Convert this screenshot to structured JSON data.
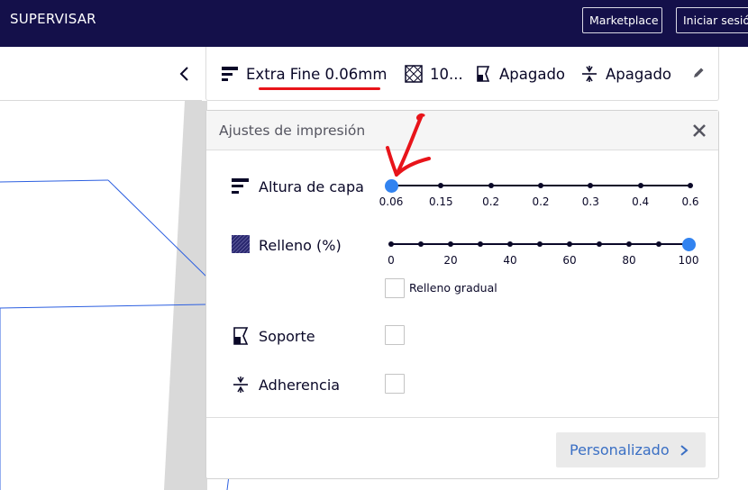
{
  "topbar": {
    "brand": "SUPERVISAR",
    "marketplace_label": "Marketplace",
    "login_label": "Iniciar sesión"
  },
  "summary": {
    "profile": "Extra Fine 0.06mm",
    "infill": "10...",
    "support": "Apagado",
    "adhesion": "Apagado"
  },
  "panel": {
    "title": "Ajustes de impresión",
    "layer_height": {
      "label": "Altura de capa",
      "ticks": [
        "0.06",
        "0.15",
        "0.2",
        "0.2",
        "0.3",
        "0.4",
        "0.6"
      ],
      "selected_index": 0
    },
    "infill": {
      "label": "Relleno (%)",
      "ticks": [
        "0",
        "20",
        "40",
        "60",
        "80",
        "100"
      ],
      "value_fraction": 1.0,
      "gradual_label": "Relleno gradual"
    },
    "support": {
      "label": "Soporte"
    },
    "adhesion": {
      "label": "Adherencia"
    },
    "custom_button": "Personalizado"
  },
  "colors": {
    "topbar": "#14104a",
    "accent_blue": "#3283f0",
    "annotation_red": "#e8141a",
    "text_dark": "#0a0828",
    "link_blue": "#3a6fc4"
  }
}
